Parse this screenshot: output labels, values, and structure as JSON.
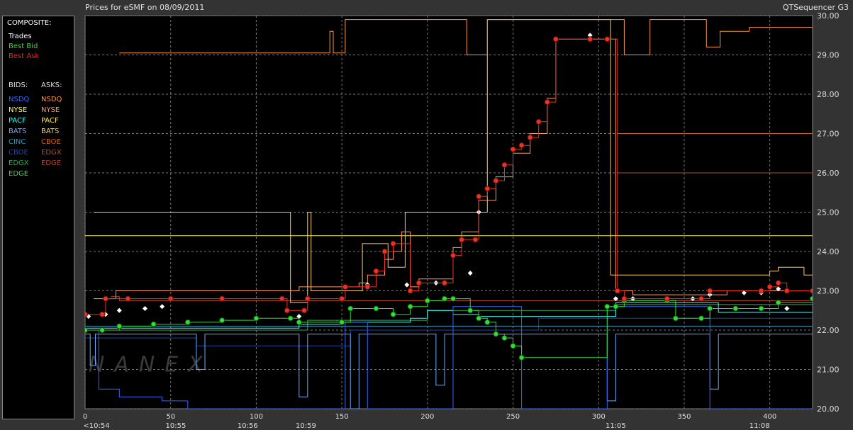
{
  "window": {
    "title_left": "Prices for  eSMF  on  08/09/2011",
    "title_right": "QTSequencer G3"
  },
  "legend": {
    "composite_label": "COMPOSITE:",
    "trades": {
      "label": "Trades",
      "color": "#ffffff"
    },
    "best_bid": {
      "label": "Best Bid",
      "color": "#33dd33"
    },
    "best_ask": {
      "label": "Best Ask",
      "color": "#ee2222"
    },
    "bids_header": "BIDS:",
    "asks_header": "ASKS:",
    "bids": [
      {
        "label": "NSDQ",
        "color": "#3366ff"
      },
      {
        "label": "NYSE",
        "color": "#ffff66"
      },
      {
        "label": "PACF",
        "color": "#33ffff"
      },
      {
        "label": "BATS",
        "color": "#66aaff"
      },
      {
        "label": "CINC",
        "color": "#3399bb"
      },
      {
        "label": "CBOE",
        "color": "#2244aa"
      },
      {
        "label": "EDGX",
        "color": "#33aa55"
      },
      {
        "label": "EDGE",
        "color": "#44cc66"
      }
    ],
    "asks": [
      {
        "label": "NSDQ",
        "color": "#ff9933"
      },
      {
        "label": "NYSE",
        "color": "#ff9966"
      },
      {
        "label": "PACF",
        "color": "#ffee55"
      },
      {
        "label": "BATS",
        "color": "#ffcc66"
      },
      {
        "label": "CBOE",
        "color": "#cc6622"
      },
      {
        "label": "EDGX",
        "color": "#aa5522"
      },
      {
        "label": "EDGE",
        "color": "#bb4422"
      }
    ]
  },
  "watermark": "NANEX",
  "chart_data": {
    "type": "line",
    "title": "Prices for  eSMF  on  08/09/2011",
    "xlim": [
      0,
      425
    ],
    "ylim": [
      20.0,
      30.0
    ],
    "x_ticks": [
      0,
      50,
      100,
      150,
      200,
      250,
      300,
      350,
      400
    ],
    "x_tick_labels": [
      "0",
      "50",
      "100",
      "150",
      "200",
      "250",
      "300",
      "350",
      "400"
    ],
    "time_labels": [
      {
        "x": 0,
        "label": "<10:54"
      },
      {
        "x": 53,
        "label": "10:55"
      },
      {
        "x": 95,
        "label": "10:56"
      },
      {
        "x": 129,
        "label": "10:59"
      },
      {
        "x": 310,
        "label": "11:05"
      },
      {
        "x": 394,
        "label": "11:08"
      }
    ],
    "y_ticks": [
      20.0,
      21.0,
      22.0,
      23.0,
      24.0,
      25.0,
      26.0,
      27.0,
      28.0,
      29.0,
      30.0
    ],
    "y_tick_labels": [
      "20.00",
      "21.00",
      "22.00",
      "23.00",
      "24.00",
      "25.00",
      "26.00",
      "27.00",
      "28.00",
      "29.00",
      "30.00"
    ],
    "grid": true,
    "series": [
      {
        "name": "Best Ask",
        "color": "#ee3322",
        "marker": "circle",
        "points": [
          [
            0,
            22.4
          ],
          [
            10,
            22.4
          ],
          [
            12,
            22.8
          ],
          [
            25,
            22.8
          ],
          [
            50,
            22.8
          ],
          [
            80,
            22.8
          ],
          [
            115,
            22.8
          ],
          [
            118,
            22.5
          ],
          [
            128,
            22.5
          ],
          [
            130,
            22.8
          ],
          [
            150,
            22.8
          ],
          [
            152,
            23.1
          ],
          [
            165,
            23.1
          ],
          [
            170,
            23.5
          ],
          [
            175,
            24.0
          ],
          [
            180,
            24.2
          ],
          [
            190,
            23.0
          ],
          [
            195,
            23.2
          ],
          [
            210,
            23.2
          ],
          [
            215,
            23.9
          ],
          [
            220,
            24.3
          ],
          [
            228,
            24.3
          ],
          [
            230,
            25.4
          ],
          [
            235,
            25.6
          ],
          [
            240,
            25.8
          ],
          [
            245,
            26.2
          ],
          [
            250,
            26.6
          ],
          [
            255,
            26.7
          ],
          [
            260,
            26.9
          ],
          [
            265,
            27.3
          ],
          [
            270,
            27.8
          ],
          [
            275,
            29.4
          ],
          [
            295,
            29.4
          ],
          [
            305,
            29.4
          ],
          [
            311,
            23.0
          ],
          [
            315,
            22.8
          ],
          [
            340,
            22.8
          ],
          [
            360,
            22.8
          ],
          [
            365,
            23.0
          ],
          [
            395,
            23.0
          ],
          [
            400,
            23.1
          ],
          [
            405,
            23.2
          ],
          [
            410,
            23.0
          ],
          [
            425,
            23.0
          ]
        ]
      },
      {
        "name": "Best Bid",
        "color": "#33dd33",
        "marker": "circle",
        "points": [
          [
            0,
            22.0
          ],
          [
            10,
            22.0
          ],
          [
            20,
            22.1
          ],
          [
            40,
            22.15
          ],
          [
            60,
            22.2
          ],
          [
            80,
            22.25
          ],
          [
            100,
            22.3
          ],
          [
            120,
            22.3
          ],
          [
            125,
            22.2
          ],
          [
            150,
            22.2
          ],
          [
            155,
            22.55
          ],
          [
            170,
            22.55
          ],
          [
            180,
            22.4
          ],
          [
            190,
            22.6
          ],
          [
            200,
            22.75
          ],
          [
            210,
            22.8
          ],
          [
            215,
            22.8
          ],
          [
            225,
            22.5
          ],
          [
            230,
            22.3
          ],
          [
            235,
            22.2
          ],
          [
            240,
            21.9
          ],
          [
            245,
            21.8
          ],
          [
            250,
            21.6
          ],
          [
            255,
            21.3
          ],
          [
            305,
            22.6
          ],
          [
            310,
            22.6
          ],
          [
            315,
            22.75
          ],
          [
            340,
            22.75
          ],
          [
            345,
            22.3
          ],
          [
            360,
            22.3
          ],
          [
            365,
            22.55
          ],
          [
            380,
            22.55
          ],
          [
            395,
            22.55
          ],
          [
            405,
            22.7
          ],
          [
            425,
            22.8
          ]
        ]
      },
      {
        "name": "Trades",
        "color": "#ffffff",
        "marker": "diamond",
        "points": [
          [
            2,
            22.35
          ],
          [
            12,
            22.4
          ],
          [
            20,
            22.5
          ],
          [
            35,
            22.55
          ],
          [
            45,
            22.6
          ],
          [
            125,
            22.35
          ],
          [
            150,
            22.8
          ],
          [
            165,
            23.15
          ],
          [
            188,
            23.15
          ],
          [
            205,
            23.2
          ],
          [
            225,
            23.45
          ],
          [
            230,
            25.0
          ],
          [
            295,
            29.5
          ],
          [
            310,
            22.8
          ],
          [
            320,
            22.8
          ],
          [
            355,
            22.8
          ],
          [
            365,
            22.9
          ],
          [
            385,
            22.95
          ],
          [
            395,
            22.95
          ],
          [
            405,
            23.05
          ],
          [
            410,
            22.55
          ]
        ]
      },
      {
        "name": "NSDQ",
        "color": "#ff9933",
        "points": [
          [
            20,
            29.05
          ],
          [
            140,
            29.05
          ],
          [
            143,
            29.6
          ],
          [
            145,
            29.05
          ],
          [
            150,
            29.05
          ],
          [
            152,
            29.9
          ],
          [
            220,
            29.9
          ],
          [
            223,
            29.0
          ],
          [
            230,
            29.0
          ],
          [
            235,
            29.9
          ],
          [
            310,
            29.9
          ],
          [
            315,
            29.0
          ],
          [
            325,
            29.0
          ],
          [
            330,
            29.9
          ],
          [
            360,
            29.9
          ],
          [
            363,
            29.2
          ],
          [
            368,
            29.2
          ],
          [
            371,
            29.6
          ],
          [
            385,
            29.6
          ],
          [
            388,
            29.7
          ],
          [
            425,
            29.7
          ]
        ]
      },
      {
        "name": "NYSE",
        "color": "#ff9966",
        "points": [
          [
            5,
            22.8
          ],
          [
            15,
            22.8
          ],
          [
            18,
            23.0
          ],
          [
            60,
            23.0
          ],
          [
            120,
            23.0
          ],
          [
            125,
            23.1
          ],
          [
            140,
            23.1
          ],
          [
            160,
            23.2
          ],
          [
            165,
            23.4
          ],
          [
            175,
            23.8
          ],
          [
            180,
            24.0
          ],
          [
            185,
            24.5
          ],
          [
            190,
            23.1
          ],
          [
            195,
            23.3
          ],
          [
            210,
            23.3
          ],
          [
            215,
            24.1
          ],
          [
            220,
            24.5
          ],
          [
            230,
            25.3
          ],
          [
            240,
            25.9
          ],
          [
            250,
            26.5
          ],
          [
            260,
            27.0
          ],
          [
            270,
            27.9
          ],
          [
            275,
            29.4
          ],
          [
            305,
            29.4
          ],
          [
            310,
            23.0
          ],
          [
            320,
            22.9
          ],
          [
            370,
            22.9
          ],
          [
            375,
            23.0
          ],
          [
            425,
            23.0
          ]
        ]
      },
      {
        "name": "PACF",
        "color": "#ffee55",
        "points": [
          [
            0,
            24.4
          ],
          [
            425,
            24.4
          ]
        ]
      },
      {
        "name": "BATS",
        "color": "#ffcc66",
        "points": [
          [
            5,
            25.0
          ],
          [
            118,
            25.0
          ],
          [
            120,
            22.7
          ],
          [
            128,
            22.7
          ],
          [
            130,
            25.0
          ],
          [
            132,
            23.0
          ],
          [
            160,
            23.0
          ],
          [
            162,
            24.2
          ],
          [
            175,
            24.2
          ],
          [
            177,
            23.6
          ],
          [
            185,
            23.6
          ],
          [
            187,
            25.0
          ],
          [
            225,
            25.0
          ],
          [
            230,
            25.0
          ],
          [
            235,
            29.9
          ],
          [
            300,
            29.9
          ],
          [
            305,
            29.9
          ],
          [
            307,
            23.4
          ],
          [
            370,
            23.4
          ],
          [
            375,
            23.4
          ],
          [
            380,
            23.4
          ],
          [
            395,
            23.4
          ],
          [
            400,
            23.5
          ],
          [
            405,
            23.6
          ],
          [
            415,
            23.6
          ],
          [
            420,
            23.4
          ],
          [
            425,
            23.4
          ]
        ]
      },
      {
        "name": "CBOE",
        "color": "#cc6622",
        "points": [
          [
            312,
            27.0
          ],
          [
            425,
            27.0
          ]
        ]
      },
      {
        "name": "EDGX",
        "color": "#aa5522",
        "points": [
          [
            312,
            26.0
          ],
          [
            425,
            26.0
          ]
        ]
      },
      {
        "name": "EDGE",
        "color": "#bb4422",
        "points": [
          [
            15,
            22.85
          ],
          [
            20,
            22.75
          ],
          [
            425,
            22.75
          ]
        ]
      },
      {
        "name": "NSDQ",
        "color": "#3366ff",
        "points": [
          [
            0,
            22.0
          ],
          [
            5,
            22.0
          ],
          [
            8,
            20.5
          ],
          [
            15,
            20.5
          ],
          [
            20,
            20.3
          ],
          [
            40,
            20.3
          ],
          [
            45,
            20.2
          ],
          [
            60,
            20.0
          ],
          [
            150,
            20.0
          ],
          [
            152,
            22.2
          ],
          [
            160,
            22.2
          ],
          [
            165,
            20.0
          ],
          [
            210,
            20.0
          ],
          [
            215,
            22.6
          ],
          [
            250,
            22.6
          ],
          [
            255,
            20.0
          ],
          [
            300,
            20.0
          ],
          [
            305,
            22.6
          ],
          [
            360,
            22.6
          ],
          [
            365,
            20.0
          ],
          [
            425,
            20.0
          ]
        ]
      },
      {
        "name": "PACF",
        "color": "#33ffff",
        "points": [
          [
            0,
            22.05
          ],
          [
            120,
            22.05
          ],
          [
            125,
            22.15
          ],
          [
            150,
            22.2
          ],
          [
            190,
            22.3
          ],
          [
            200,
            22.5
          ],
          [
            210,
            22.5
          ],
          [
            215,
            22.4
          ],
          [
            230,
            22.35
          ],
          [
            260,
            22.35
          ],
          [
            300,
            22.35
          ],
          [
            310,
            22.7
          ],
          [
            360,
            22.7
          ],
          [
            370,
            22.45
          ],
          [
            425,
            22.45
          ]
        ]
      },
      {
        "name": "BATS",
        "color": "#66aaff",
        "points": [
          [
            0,
            21.9
          ],
          [
            3,
            21.1
          ],
          [
            6,
            21.9
          ],
          [
            60,
            21.9
          ],
          [
            65,
            21.0
          ],
          [
            70,
            21.9
          ],
          [
            120,
            21.9
          ],
          [
            125,
            20.3
          ],
          [
            130,
            21.9
          ],
          [
            150,
            21.9
          ],
          [
            155,
            20.0
          ],
          [
            160,
            21.9
          ],
          [
            200,
            21.9
          ],
          [
            205,
            20.6
          ],
          [
            210,
            21.9
          ],
          [
            300,
            21.9
          ],
          [
            305,
            20.2
          ],
          [
            310,
            21.9
          ],
          [
            360,
            21.9
          ],
          [
            365,
            20.5
          ],
          [
            370,
            21.9
          ],
          [
            425,
            21.9
          ]
        ]
      },
      {
        "name": "CINC",
        "color": "#3399bb",
        "points": [
          [
            0,
            22.1
          ],
          [
            425,
            22.1
          ]
        ]
      },
      {
        "name": "CBOE",
        "color": "#2244aa",
        "points": [
          [
            0,
            21.8
          ],
          [
            60,
            21.8
          ],
          [
            65,
            21.6
          ],
          [
            150,
            21.6
          ],
          [
            155,
            22.0
          ],
          [
            260,
            22.0
          ],
          [
            265,
            22.3
          ],
          [
            425,
            22.3
          ]
        ]
      },
      {
        "name": "EDGX",
        "color": "#33aa55",
        "points": [
          [
            0,
            22.0
          ],
          [
            120,
            22.0
          ],
          [
            130,
            22.25
          ],
          [
            200,
            22.5
          ],
          [
            300,
            22.5
          ],
          [
            310,
            22.65
          ],
          [
            425,
            22.65
          ]
        ]
      }
    ]
  }
}
